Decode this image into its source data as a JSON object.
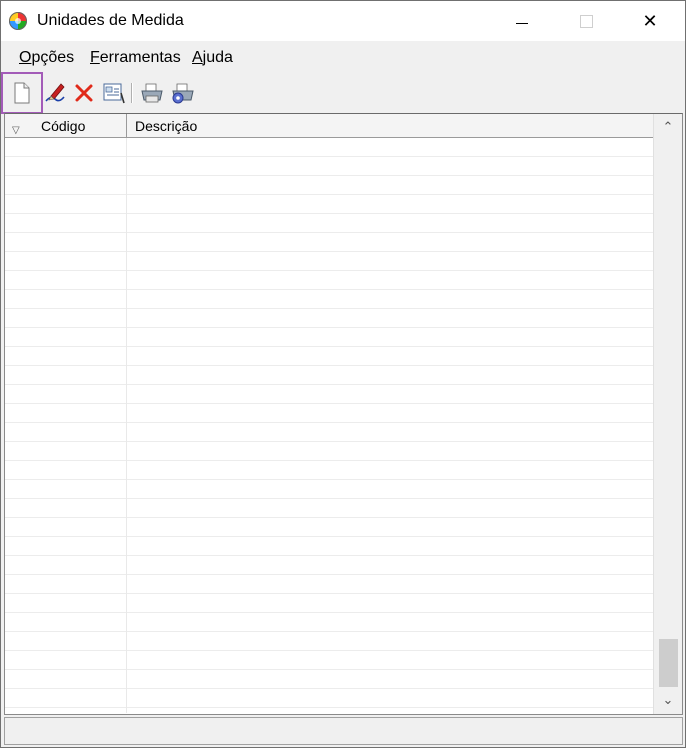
{
  "window": {
    "title": "Unidades de Medida",
    "icon": "app-globe-icon",
    "controls": {
      "minimize": "minimize-icon",
      "maximize": "maximize-icon",
      "close_glyph": "✕"
    }
  },
  "menu": {
    "items": [
      {
        "accel": "O",
        "rest": "pções"
      },
      {
        "accel": "F",
        "rest": "erramentas"
      },
      {
        "accel": "A",
        "rest": "juda"
      }
    ]
  },
  "toolbar": {
    "buttons": [
      "new-document-icon",
      "edit-pencil-icon",
      "delete-x-icon",
      "search-icon",
      "print-icon",
      "print-setup-icon"
    ],
    "highlight_color": "#a35bb8"
  },
  "grid": {
    "columns": [
      {
        "label": "Código"
      },
      {
        "label": "Descrição"
      }
    ],
    "sort_glyph": "▽",
    "rows": []
  },
  "scrollbar": {
    "up_glyph": "⌃",
    "down_glyph": "⌄"
  }
}
